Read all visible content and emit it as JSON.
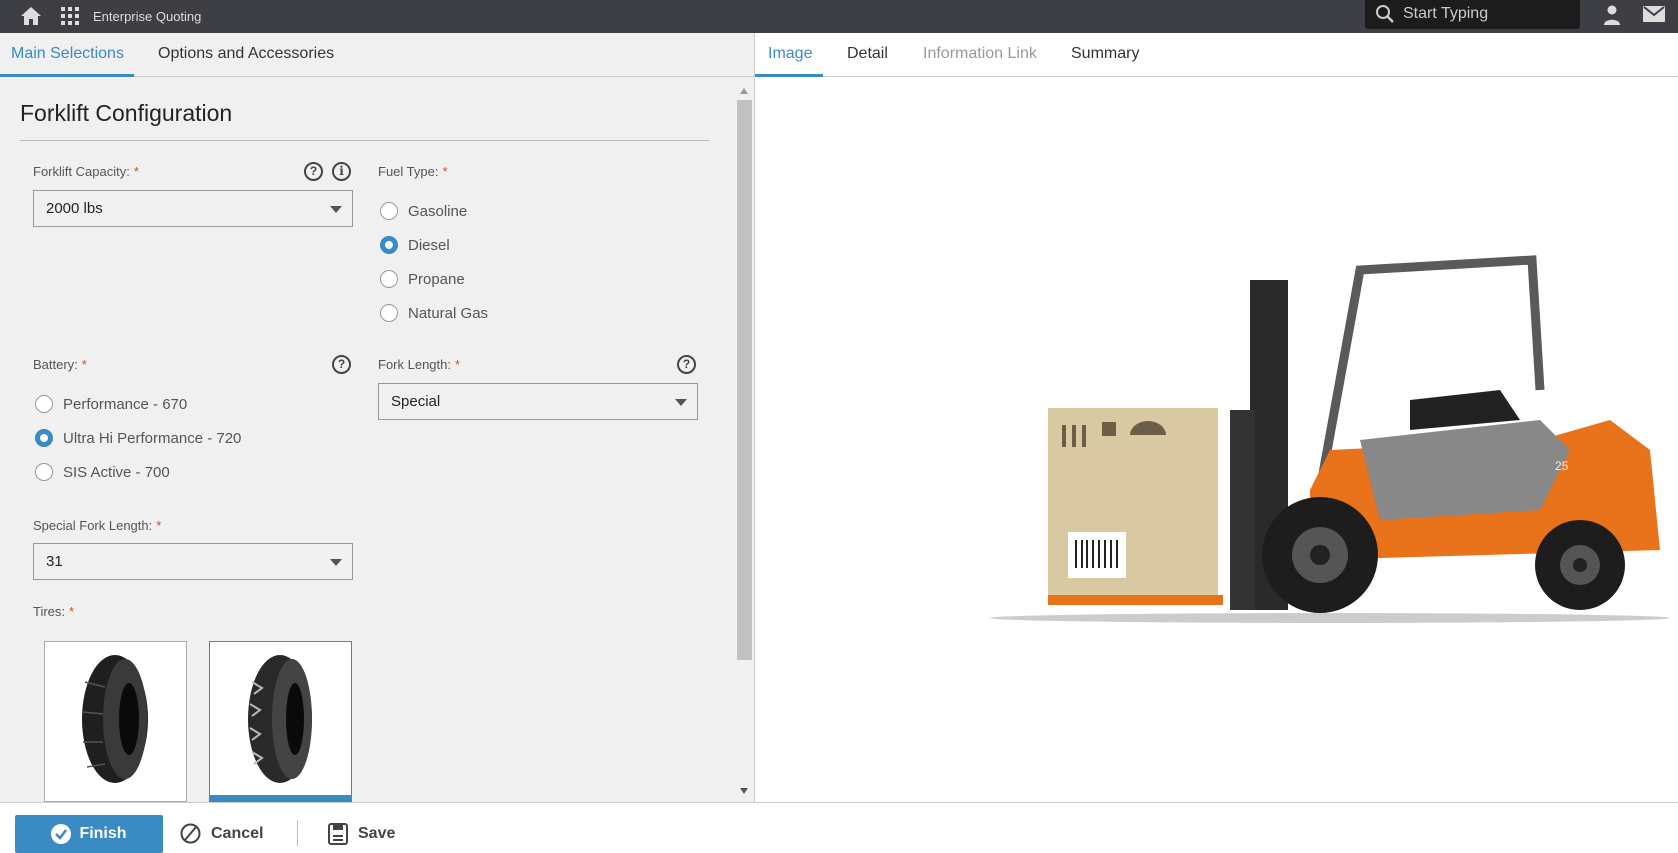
{
  "topbar": {
    "app_title": "Enterprise Quoting",
    "search_placeholder": "Start Typing"
  },
  "left_tabs": [
    {
      "label": "Main Selections",
      "active": true
    },
    {
      "label": "Options and Accessories",
      "active": false
    }
  ],
  "right_tabs": [
    {
      "label": "Image",
      "active": true
    },
    {
      "label": "Detail"
    },
    {
      "label": "Information Link",
      "disabled": true
    },
    {
      "label": "Summary"
    }
  ],
  "form": {
    "title": "Forklift Configuration",
    "capacity": {
      "label": "Forklift Capacity:",
      "required": "*",
      "value": "2000 lbs"
    },
    "fuel": {
      "label": "Fuel Type:",
      "required": "*",
      "options": [
        "Gasoline",
        "Diesel",
        "Propane",
        "Natural Gas"
      ],
      "selected": "Diesel"
    },
    "battery": {
      "label": "Battery:",
      "required": "*",
      "options": [
        "Performance - 670",
        "Ultra Hi Performance - 720",
        "SIS Active - 700"
      ],
      "selected": "Ultra Hi Performance - 720"
    },
    "fork_length": {
      "label": "Fork Length:",
      "required": "*",
      "value": "Special"
    },
    "special_fork_length": {
      "label": "Special Fork Length:",
      "required": "*",
      "value": "31"
    },
    "tires": {
      "label": "Tires:",
      "required": "*",
      "selected_index": 1
    },
    "help": "?",
    "info": "i"
  },
  "image": {
    "model_badge": "25"
  },
  "footer": {
    "finish": "Finish",
    "cancel": "Cancel",
    "save": "Save"
  },
  "colors": {
    "accent": "#3a8ac4",
    "topbar": "#3e3f44",
    "required": "#c8501e",
    "forklift": "#e8731a"
  }
}
